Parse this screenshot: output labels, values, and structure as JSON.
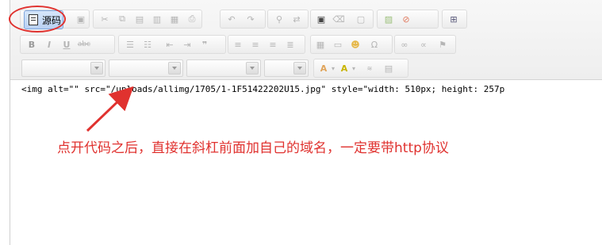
{
  "toolbar": {
    "source_button_label": "源码"
  },
  "editor": {
    "source_code_line": "<img alt=\"\" src=\"/uploads/allimg/1705/1-1F51422202U15.jpg\" style=\"width: 510px; height: 257p"
  },
  "annotation": {
    "text": "点开代码之后，直接在斜杠前面加自己的域名，一定要带http协议",
    "color": "#e0322f"
  }
}
